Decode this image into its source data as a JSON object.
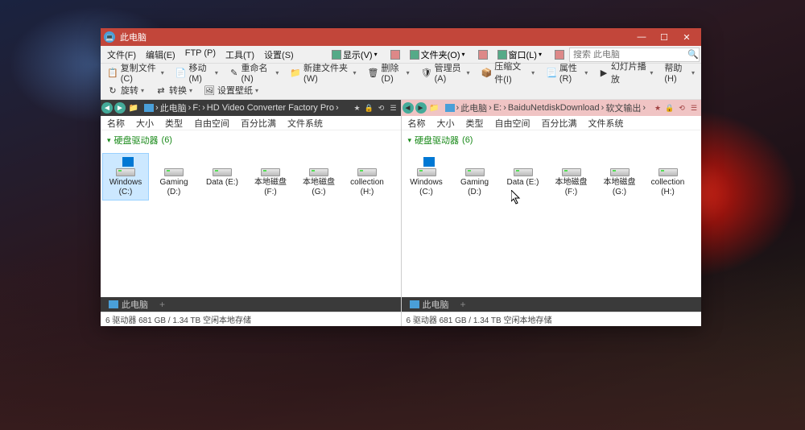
{
  "window": {
    "title": "此电脑"
  },
  "win_controls": {
    "min": "—",
    "max": "☐",
    "close": "✕"
  },
  "menus": [
    "文件(F)",
    "编辑(E)",
    "FTP (P)",
    "工具(T)",
    "设置(S)"
  ],
  "right_menus": [
    {
      "label": "显示(V)",
      "icon": "view"
    },
    {
      "label": "文件夹(O)",
      "icon": "folder"
    },
    {
      "label": "窗口(L)",
      "icon": "window"
    }
  ],
  "search": {
    "placeholder": "搜索 此电脑"
  },
  "toolbar": {
    "row1": [
      {
        "label": "复制文件(C)",
        "icon": "📋"
      },
      {
        "label": "移动(M)",
        "icon": "📄"
      },
      {
        "label": "重命名(N)",
        "icon": "✎"
      },
      {
        "label": "新建文件夹(W)",
        "icon": "📁"
      },
      {
        "label": "删除(D)",
        "icon": "🗑"
      },
      {
        "label": "管理员(A)",
        "icon": "🛡"
      },
      {
        "label": "压缩文件(I)",
        "icon": "📦"
      },
      {
        "label": "属性(R)",
        "icon": "📃"
      },
      {
        "label": "幻灯片播放",
        "icon": "▶"
      }
    ],
    "row2": [
      {
        "label": "旋转",
        "icon": "↻"
      },
      {
        "label": "转换",
        "icon": "⇄"
      },
      {
        "label": "设置壁纸",
        "icon": "🖼"
      }
    ],
    "help": "帮助(H)"
  },
  "columns": [
    "名称",
    "大小",
    "类型",
    "自由空间",
    "百分比满",
    "文件系统"
  ],
  "group": {
    "label": "硬盘驱动器",
    "count": "(6)"
  },
  "drives": [
    {
      "label": "Windows (C:)",
      "win": true
    },
    {
      "label": "Gaming (D:)"
    },
    {
      "label": "Data (E:)"
    },
    {
      "label": "本地磁盘 (F:)"
    },
    {
      "label": "本地磁盘 (G:)"
    },
    {
      "label": "collection (H:)"
    }
  ],
  "panes": {
    "left": {
      "path": [
        "此电脑",
        "F:",
        "HD Video Converter Factory Pro"
      ],
      "selected_drive": 0
    },
    "right": {
      "path": [
        "此电脑",
        "E:",
        "BaiduNetdiskDownload",
        "软文输出"
      ],
      "selected_drive": -1
    }
  },
  "tab": {
    "label": "此电脑"
  },
  "status": "6 驱动器  681 GB / 1.34 TB 空闲本地存储"
}
